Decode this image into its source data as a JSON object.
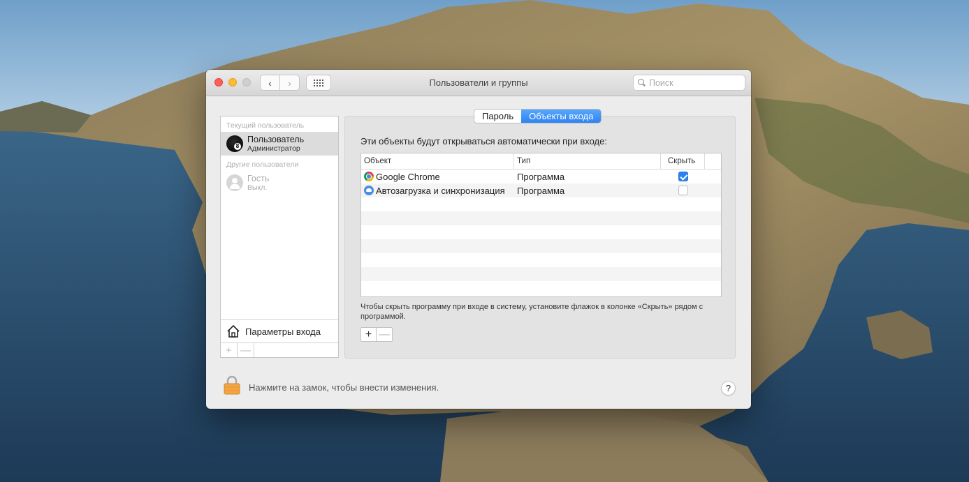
{
  "window": {
    "title": "Пользователи и группы",
    "search_placeholder": "Поиск"
  },
  "nav": {
    "back": "‹",
    "forward": "›"
  },
  "sidebar": {
    "current_section": "Текущий пользователь",
    "current_user": {
      "name": "Пользователь",
      "role": "Администратор"
    },
    "other_section": "Другие пользователи",
    "other_users": [
      {
        "name": "Гость",
        "role": "Выкл."
      }
    ],
    "login_options": "Параметры входа",
    "add_label": "+",
    "remove_label": "—"
  },
  "tabs": [
    {
      "label": "Пароль",
      "active": false
    },
    {
      "label": "Объекты входа",
      "active": true
    }
  ],
  "login_items": {
    "caption": "Эти объекты будут открываться автоматически при входе:",
    "columns": [
      "Объект",
      "Тип",
      "Скрыть"
    ],
    "rows": [
      {
        "name": "Google Chrome",
        "icon": "chrome-icon",
        "type": "Программа",
        "hide": true
      },
      {
        "name": "Автозагрузка и синхронизация",
        "icon": "backup-sync-icon",
        "type": "Программа",
        "hide": false
      }
    ],
    "hint": "Чтобы скрыть программу при входе в систему, установите флажок в колонке «Скрыть» рядом с программой.",
    "add_label": "+",
    "remove_label": "—"
  },
  "footer": {
    "lock_text": "Нажмите на замок, чтобы внести изменения.",
    "help_label": "?"
  },
  "colors": {
    "accent": "#2c82f3",
    "window_bg": "#ececec"
  }
}
